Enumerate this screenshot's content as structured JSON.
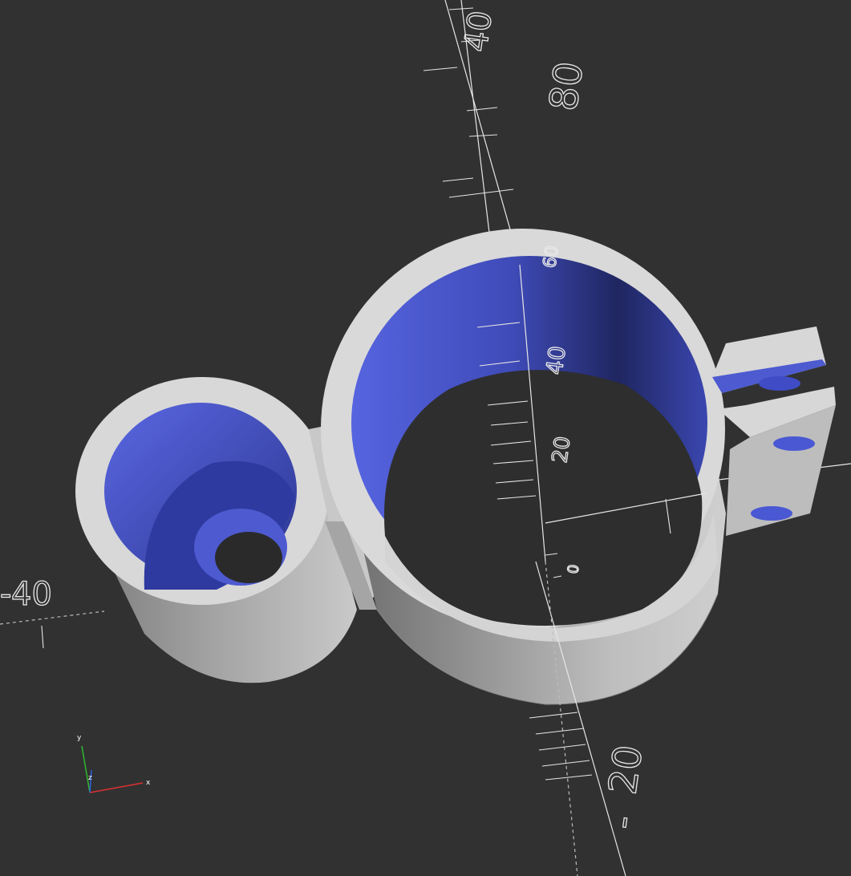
{
  "viewport": {
    "background": "#313131",
    "part_colors": {
      "face": "#d9d9d9",
      "side": "#9e9e9e",
      "inner": "#4e5bd6"
    },
    "axis_labels": {
      "y_upper_a": "40",
      "y_upper_b": "80",
      "y_inner_60": "60",
      "y_inner_40": "40",
      "y_inner_20": "20",
      "y_inner_0": "0",
      "x_left": "40",
      "x_left_sign": "-",
      "z_bottom": "20",
      "z_bottom_sign": "-"
    },
    "gizmo": {
      "x": "x",
      "y": "y",
      "z": "z"
    }
  }
}
